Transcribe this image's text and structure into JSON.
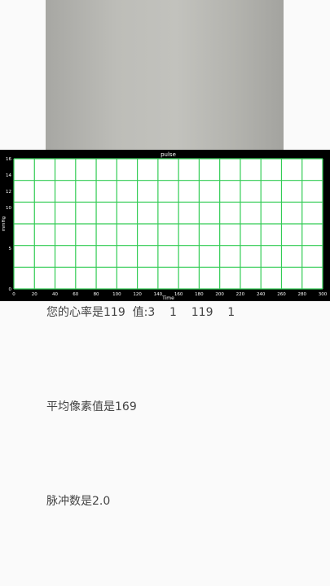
{
  "preview": {
    "icon": "camera-preview"
  },
  "texts": {
    "heart_rate": "您的心率是119  值:3    1    119    1",
    "avg_pixel": "平均像素值是169",
    "pulse_count": "脉冲数是2.0"
  },
  "chart_data": {
    "type": "line",
    "title": "pulse",
    "xlabel": "Time",
    "ylabel": "mmHg",
    "xlim": [
      0,
      300
    ],
    "ylim": [
      0,
      16
    ],
    "x_ticks": [
      0,
      20,
      40,
      60,
      80,
      100,
      120,
      140,
      160,
      180,
      200,
      220,
      240,
      260,
      280,
      300
    ],
    "y_ticks": [
      0,
      5,
      10,
      12,
      14,
      16
    ],
    "grid": true,
    "grid_color": "#33cc55",
    "series": []
  }
}
